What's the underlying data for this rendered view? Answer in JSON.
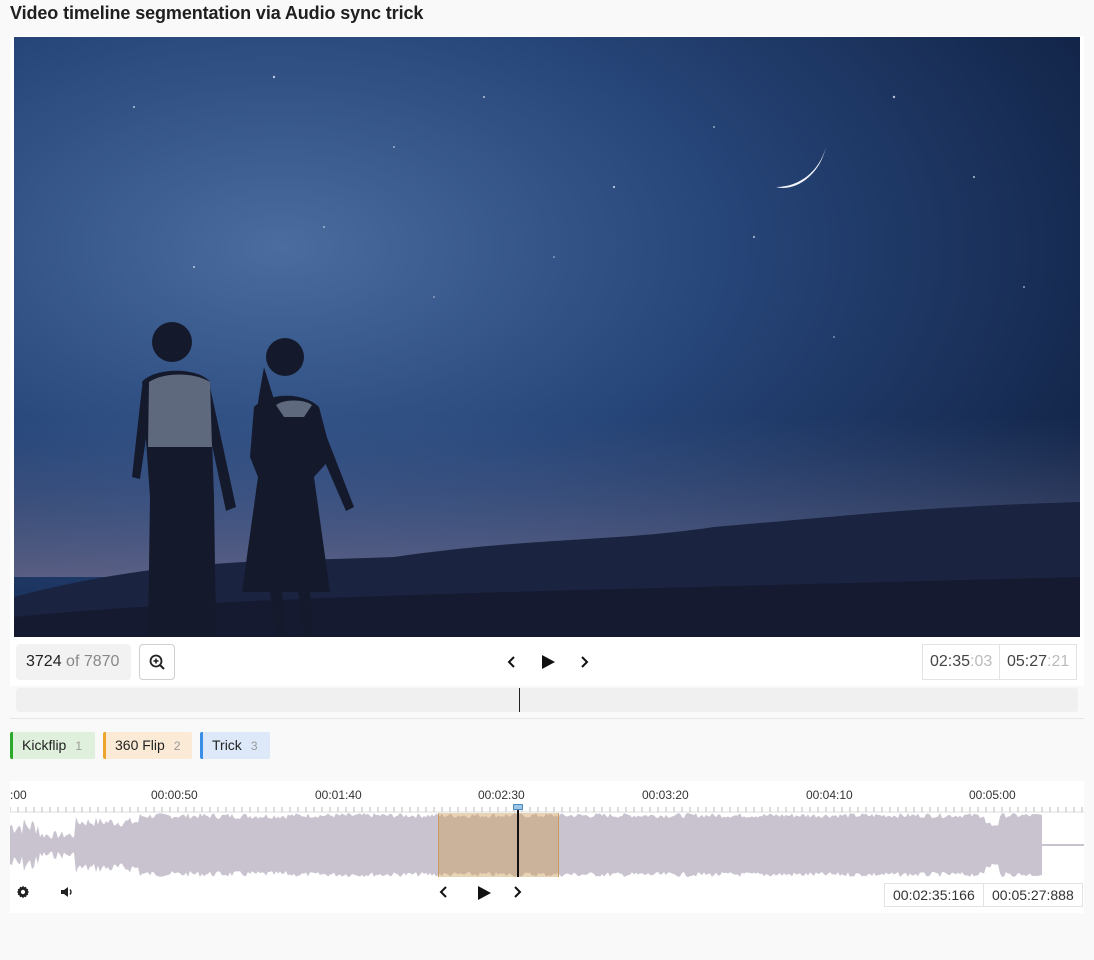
{
  "page": {
    "title": "Video timeline segmentation via Audio sync trick"
  },
  "player": {
    "frame_current": "3724",
    "frame_of": "of 7870",
    "time_current_main": "02:35",
    "time_current_ms": ":03",
    "time_total_main": "05:27",
    "time_total_ms": ":21",
    "progress_fraction": 0.473
  },
  "labels": [
    {
      "name": "Kickflip",
      "hotkey": "1",
      "color": "#2aa92a"
    },
    {
      "name": "360 Flip",
      "hotkey": "2",
      "color": "#eea530"
    },
    {
      "name": "Trick",
      "hotkey": "3",
      "color": "#3a8ee6"
    }
  ],
  "timeline": {
    "ticks": [
      ":00",
      "00:00:50",
      "00:01:40",
      "00:02:30",
      "00:03:20",
      "00:04:10",
      "00:05:00"
    ],
    "time_current": "00:02:35:166",
    "time_total": "00:05:27:888"
  },
  "icons": {
    "zoom": "zoom-in-icon",
    "prev": "chevron-left-icon",
    "play": "play-icon",
    "next": "chevron-right-icon",
    "settings": "gear-icon",
    "volume": "volume-icon"
  }
}
